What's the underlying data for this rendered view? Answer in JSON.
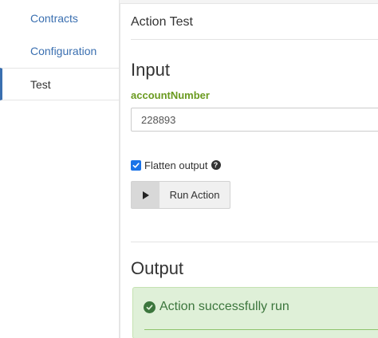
{
  "sidebar": {
    "items": [
      {
        "label": "Contracts"
      },
      {
        "label": "Configuration"
      },
      {
        "label": "Test"
      }
    ]
  },
  "card": {
    "title": "Action Test"
  },
  "input_section": {
    "heading": "Input",
    "field_label": "accountNumber",
    "field_value": "228893",
    "flatten_label": "Flatten output",
    "flatten_checked": true,
    "help_glyph": "?",
    "run_button_label": "Run Action"
  },
  "output_section": {
    "heading": "Output",
    "status_message": "Action successfully run"
  },
  "colors": {
    "link": "#3a6fb0",
    "field_label": "#6a9a1f",
    "success_bg": "#dff0d8",
    "success_text": "#3c763d",
    "checkbox": "#1a73e8"
  },
  "icons": {
    "run": "play-icon",
    "help": "question-circle-icon",
    "success": "check-circle-icon",
    "checkbox": "checkmark-icon"
  }
}
